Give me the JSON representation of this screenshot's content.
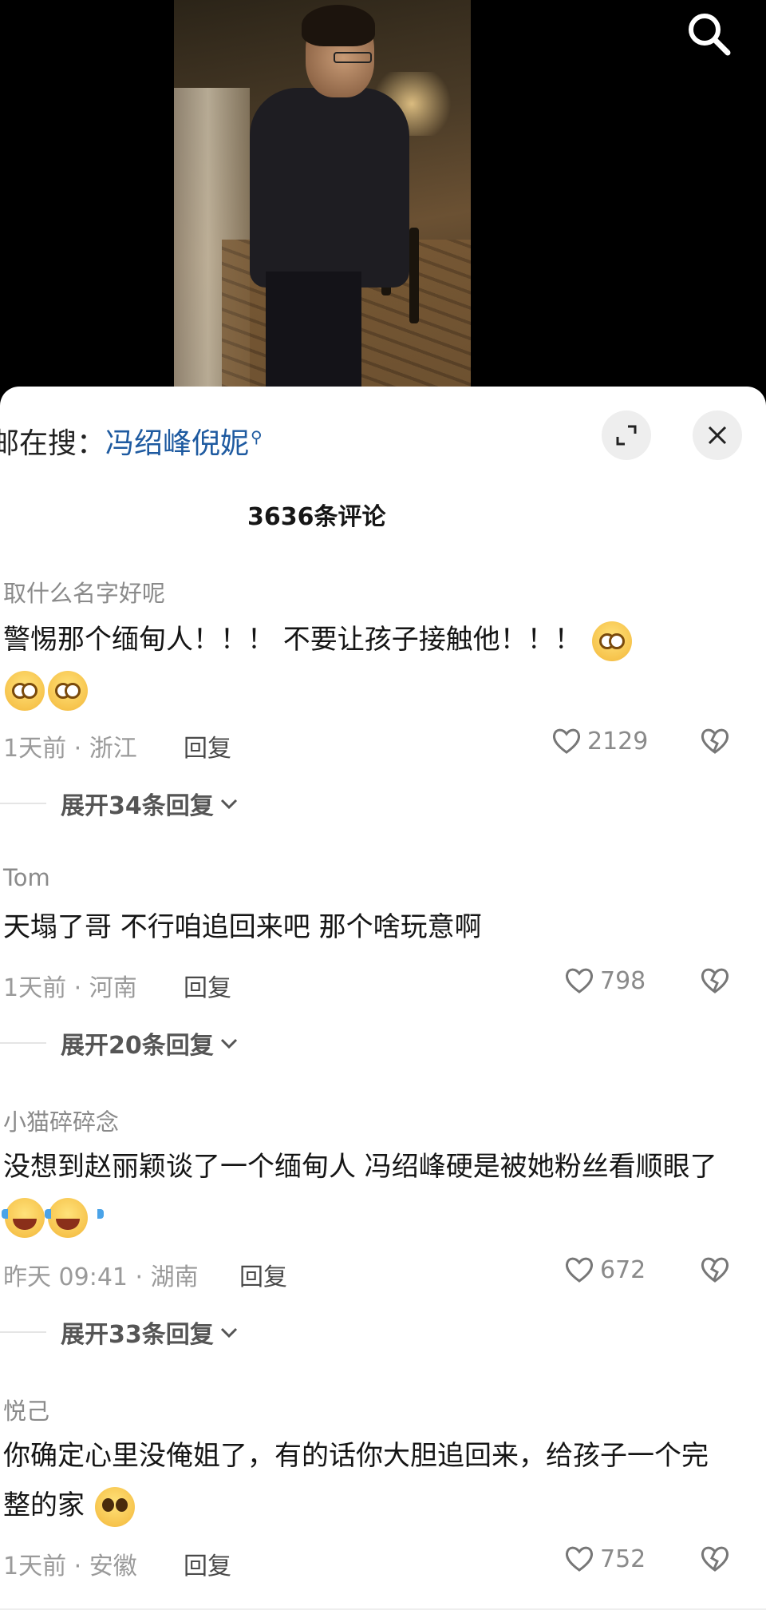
{
  "searching": {
    "prefix": "邮在搜：",
    "keyword": "冯绍峰倪妮"
  },
  "comment_count": "3636条评论",
  "comments": [
    {
      "user": "取什么名字好呢",
      "text": "警惕那个缅甸人！！！ 不要让孩子接触他！！！",
      "emojis": [
        "dizzy-face-emoji",
        "dizzy-face-emoji",
        "dizzy-face-emoji"
      ],
      "meta": "1天前 · 浙江",
      "reply": "回复",
      "likes": "2129",
      "expand": "展开34条回复"
    },
    {
      "user": "Tom",
      "text": "天塌了哥 不行咱追回来吧 那个啥玩意啊",
      "emojis": [],
      "meta": "1天前 · 河南",
      "reply": "回复",
      "likes": "798",
      "expand": "展开20条回复"
    },
    {
      "user": "小猫碎碎念",
      "text": "没想到赵丽颖谈了一个缅甸人 冯绍峰硬是被她粉丝看顺眼了",
      "emojis": [
        "laugh-cry-emoji",
        "laugh-cry-emoji"
      ],
      "meta": "昨天 09:41 · 湖南",
      "reply": "回复",
      "likes": "672",
      "expand": "展开33条回复"
    },
    {
      "user": "悦己",
      "text": "你确定心里没俺姐了，有的话你大胆追回来，给孩子一个完整的家",
      "emojis": [
        "pleading-face-emoji"
      ],
      "meta": "1天前 · 安徽",
      "reply": "回复",
      "likes": "752"
    }
  ],
  "colors": {
    "keyword": "#1e5aa0",
    "sheet_bg": "#ffffff",
    "meta": "#9a9a9a"
  }
}
